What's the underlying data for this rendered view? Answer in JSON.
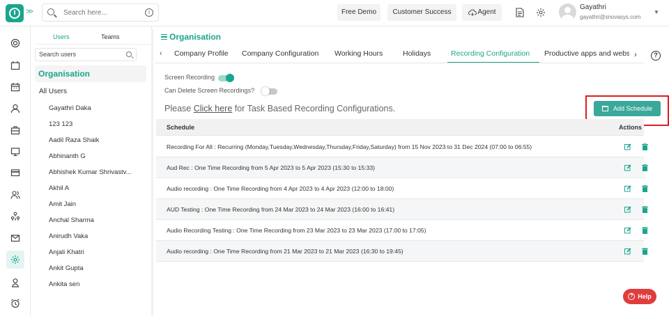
{
  "colors": {
    "accent": "#1aa58d",
    "button": "#3aa89a",
    "highlight": "#e21b1b",
    "help": "#e13c3c"
  },
  "header": {
    "search_placeholder": "Search here...",
    "buttons": [
      "Free Demo",
      "Customer Success",
      "Agent"
    ],
    "user": {
      "name": "Gayathri",
      "email": "gayathri@snovasys.com"
    }
  },
  "rail_icons": [
    "dashboard-icon",
    "calendar-icon",
    "calendar-grid-icon",
    "user-icon",
    "briefcase-icon",
    "monitor-icon",
    "card-icon",
    "users-icon",
    "org-chart-icon",
    "mail-icon",
    "settings-icon",
    "user-badge-icon",
    "alarm-icon"
  ],
  "panel": {
    "tabs": [
      "Users",
      "Teams"
    ],
    "search_placeholder": "Search users",
    "heading": "Organisation",
    "all_users": "All Users",
    "users": [
      "Gayathri Daka",
      "123 123",
      "Aadil Raza Shaik",
      "Abhinanth G",
      "Abhishek Kumar Shrivastv...",
      "Akhil A",
      "Amit Jain",
      "Anchal Sharma",
      "Anirudh Vaka",
      "Anjali Khatri",
      "Ankit Gupta",
      "Ankita sen"
    ]
  },
  "main": {
    "title": "Organisation",
    "tabs": [
      "Company Profile",
      "Company Configuration",
      "Working Hours",
      "Holidays",
      "Recording Configuration",
      "Productive apps and websites"
    ],
    "active_tab": "Recording Configuration",
    "screen_recording_label": "Screen Recording",
    "screen_recording_on": true,
    "can_delete_label": "Can Delete Screen Recordings?",
    "can_delete_on": false,
    "notice_prefix": "Please ",
    "notice_link": "Click here",
    "notice_suffix": " for Task Based Recording Configurations.",
    "add_button": "Add Schedule",
    "table": {
      "headers": [
        "Schedule",
        "Actions"
      ],
      "rows": [
        "Recording For All : Recurring (Monday,Tuesday,Wednesday,Thursday,Friday,Saturday) from 15 Nov 2023 to 31 Dec 2024 (07:00 to 06:55)",
        "Aud Rec : One Time Recording from 5 Apr 2023 to 5 Apr 2023 (15:30 to 15:33)",
        "Audio recording : One Time Recording from 4 Apr 2023 to 4 Apr 2023 (12:00 to 18:00)",
        "AUD Testing : One Time Recording from 24 Mar 2023 to 24 Mar 2023 (16:00 to 16:41)",
        "Audio Recording Testing : One Time Recording from 23 Mar 2023 to 23 Mar 2023 (17:00 to 17:05)",
        "Audio recording : One Time Recording from 21 Mar 2023 to 21 Mar 2023 (16:30 to 19:45)"
      ]
    }
  },
  "help_button": "Help"
}
